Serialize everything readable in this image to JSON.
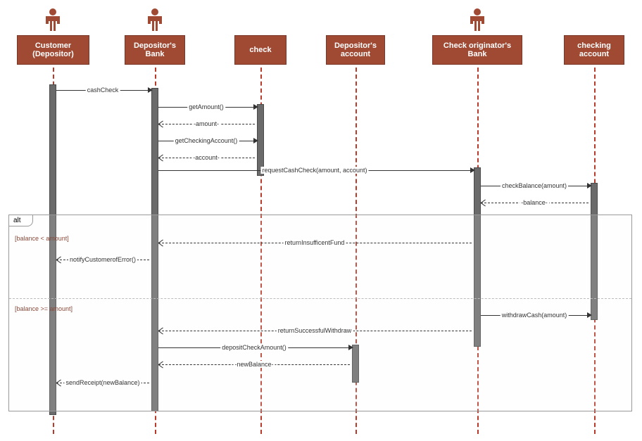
{
  "participants": {
    "customer": "Customer (Depositor)",
    "depBank": "Depositor's Bank",
    "check": "check",
    "depAcct": "Depositor's account",
    "origBank": "Check originator's Bank",
    "chkAcct": "checking account"
  },
  "messages": {
    "m1": "cashCheck",
    "m2": "getAmount()",
    "m3": "-amount-",
    "m4": "getCheckingAccount()",
    "m5": "-account-",
    "m6": "requestCashCheck(amount, account)",
    "m7": "checkBalance(amount)",
    "m8": "-balance-",
    "m9": "returnInsufficentFund",
    "m10": "notifyCustomerofError()",
    "m11": "withdrawCash(amount)",
    "m12": "returnSuccessfulWithdraw",
    "m13": "depositCheckAmount()",
    "m14": "-newBalance-",
    "m15": "sendReceipt(newBalance)"
  },
  "frame": {
    "altLabel": "alt",
    "guard1": "[balance < amount]",
    "guard2": "[balance >= amount]"
  },
  "chart_data": {
    "type": "sequence_diagram",
    "actors": [
      "Customer (Depositor)",
      "Depositor's Bank",
      "Check originator's Bank"
    ],
    "objects": [
      "check",
      "Depositor's account",
      "checking account"
    ],
    "participants": [
      "Customer (Depositor)",
      "Depositor's Bank",
      "check",
      "Depositor's account",
      "Check originator's Bank",
      "checking account"
    ],
    "messages": [
      {
        "from": "Customer (Depositor)",
        "to": "Depositor's Bank",
        "label": "cashCheck",
        "type": "sync"
      },
      {
        "from": "Depositor's Bank",
        "to": "check",
        "label": "getAmount()",
        "type": "sync"
      },
      {
        "from": "check",
        "to": "Depositor's Bank",
        "label": "-amount-",
        "type": "return"
      },
      {
        "from": "Depositor's Bank",
        "to": "check",
        "label": "getCheckingAccount()",
        "type": "sync"
      },
      {
        "from": "check",
        "to": "Depositor's Bank",
        "label": "-account-",
        "type": "return"
      },
      {
        "from": "Depositor's Bank",
        "to": "Check originator's Bank",
        "label": "requestCashCheck(amount, account)",
        "type": "sync"
      },
      {
        "from": "Check originator's Bank",
        "to": "checking account",
        "label": "checkBalance(amount)",
        "type": "sync"
      },
      {
        "from": "checking account",
        "to": "Check originator's Bank",
        "label": "-balance-",
        "type": "return"
      }
    ],
    "fragments": [
      {
        "type": "alt",
        "operands": [
          {
            "guard": "[balance < amount]",
            "messages": [
              {
                "from": "Check originator's Bank",
                "to": "Depositor's Bank",
                "label": "returnInsufficentFund",
                "type": "return"
              },
              {
                "from": "Depositor's Bank",
                "to": "Customer (Depositor)",
                "label": "notifyCustomerofError()",
                "type": "return"
              }
            ]
          },
          {
            "guard": "[balance >= amount]",
            "messages": [
              {
                "from": "Check originator's Bank",
                "to": "checking account",
                "label": "withdrawCash(amount)",
                "type": "sync"
              },
              {
                "from": "Check originator's Bank",
                "to": "Depositor's Bank",
                "label": "returnSuccessfulWithdraw",
                "type": "return"
              },
              {
                "from": "Depositor's Bank",
                "to": "Depositor's account",
                "label": "depositCheckAmount()",
                "type": "sync"
              },
              {
                "from": "Depositor's account",
                "to": "Depositor's Bank",
                "label": "-newBalance-",
                "type": "return"
              },
              {
                "from": "Depositor's Bank",
                "to": "Customer (Depositor)",
                "label": "sendReceipt(newBalance)",
                "type": "return"
              }
            ]
          }
        ]
      }
    ]
  }
}
